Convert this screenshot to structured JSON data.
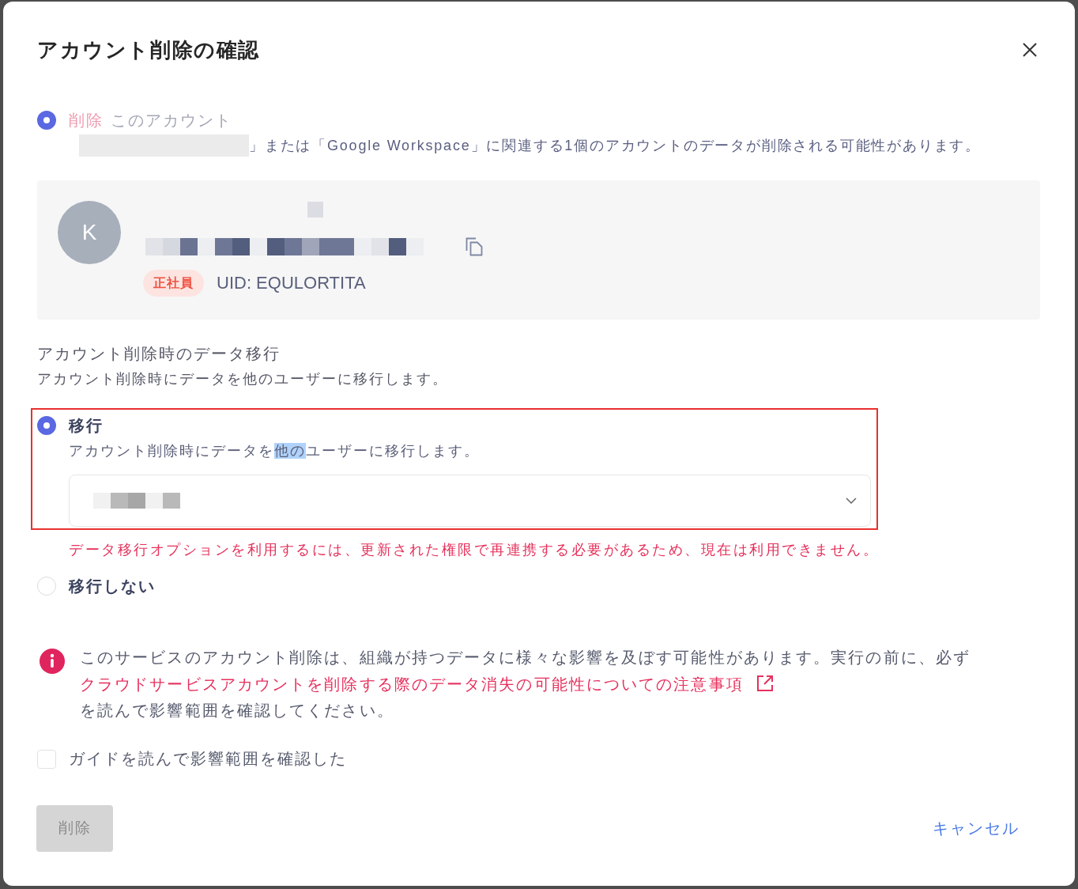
{
  "dialog": {
    "title": "アカウント削除の確認"
  },
  "delete_option": {
    "selected": true,
    "verb": "削除",
    "object": "このアカウント",
    "description": "」または「Google Workspace」に関連する1個のアカウントのデータが削除される可能性があります。"
  },
  "account_card": {
    "avatar_initial": "K",
    "badge": "正社員",
    "uid": "UID: EQULORTITA"
  },
  "migration": {
    "title": "アカウント削除時のデータ移行",
    "description": "アカウント削除時にデータを他のユーザーに移行します。",
    "options": [
      {
        "kind": "with_target",
        "label": "移行",
        "selected": true,
        "highlighted": true,
        "description_parts": [
          {
            "text": "アカウント削除時にデータを",
            "selected": false
          },
          {
            "text": "他の",
            "selected": true
          },
          {
            "text": "ユーザーに移行します。",
            "selected": false
          }
        ],
        "error": "データ移行オプションを利用するには、更新された権限で再連携する必要があるため、現在は利用できません。"
      },
      {
        "kind": "plain",
        "label": "移行しない",
        "selected": false,
        "highlighted": false
      }
    ]
  },
  "notice": {
    "text_before": "このサービスのアカウント削除は、組織が持つデータに様々な影響を及ぼす可能性があります。実行の前に、必ず",
    "link": "クラウドサービスアカウントを削除する際のデータ消失の可能性についての注意事項",
    "text_after": "を読んで影響範囲を確認してください。"
  },
  "confirm_checkbox": {
    "label": "ガイドを読んで影響範囲を確認した",
    "checked": false
  },
  "buttons": [
    {
      "kind": "danger",
      "label": "削除",
      "disabled": true
    },
    {
      "kind": "cancel",
      "label": "キャンセル",
      "disabled": false
    }
  ]
}
